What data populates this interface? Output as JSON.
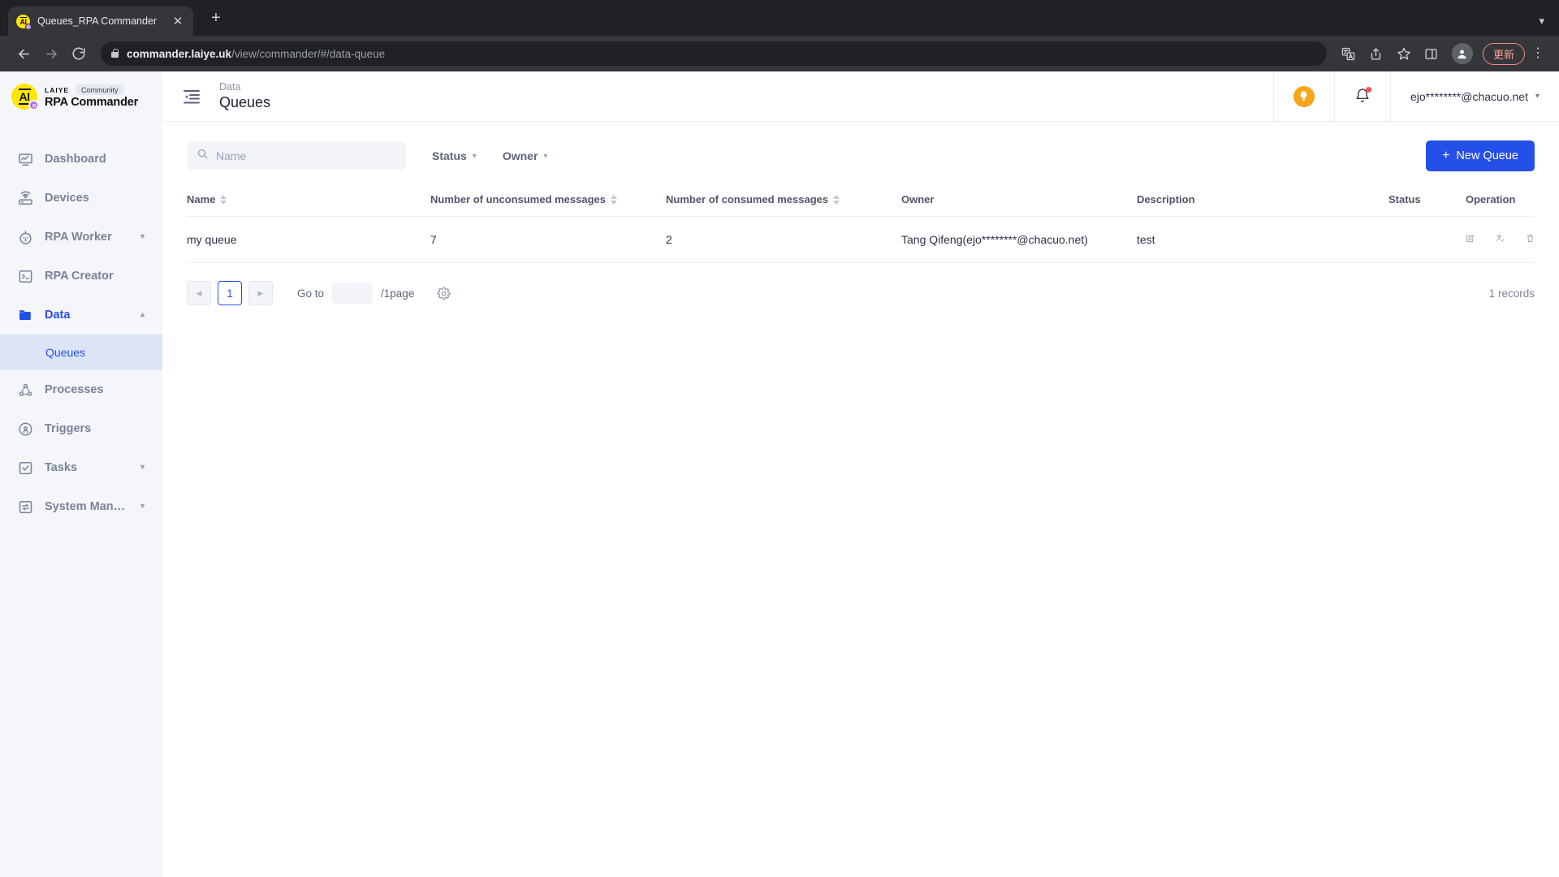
{
  "browser": {
    "tab": {
      "title": "Queues_RPA Commander",
      "favicon_icon": "laiye-ai-favicon",
      "close_icon": "close-icon"
    },
    "new_tab_icon": "plus-icon",
    "window_minimize_icon": "chevron-down-icon",
    "nav": {
      "back_icon": "back-arrow-icon",
      "forward_icon": "forward-arrow-icon",
      "reload_icon": "reload-icon"
    },
    "omnibox": {
      "lock_icon": "lock-icon",
      "domain": "commander.laiye.uk",
      "path": "/view/commander/#/data-queue"
    },
    "toolbar_icons": [
      "translate-icon",
      "share-icon",
      "bookmark-star-icon",
      "side-panel-icon",
      "profile-avatar-icon"
    ],
    "update_label": "更新",
    "menu_icon": "kebab-menu-icon"
  },
  "sidebar": {
    "brand": {
      "laiye": "LAIYE",
      "community": "Community",
      "name": "RPA Commander",
      "logo_icon": "laiye-ai-logo"
    },
    "items": [
      {
        "label": "Dashboard",
        "icon": "dashboard-monitor-icon",
        "expandable": false,
        "active": false
      },
      {
        "label": "Devices",
        "icon": "device-router-icon",
        "expandable": false,
        "active": false
      },
      {
        "label": "RPA Worker",
        "icon": "robot-icon",
        "expandable": true,
        "active": false,
        "chevron": "chevron-down-icon"
      },
      {
        "label": "RPA Creator",
        "icon": "terminal-icon",
        "expandable": false,
        "active": false
      },
      {
        "label": "Data",
        "icon": "folder-icon",
        "expandable": true,
        "active": true,
        "chevron": "chevron-up-icon"
      },
      {
        "label": "Processes",
        "icon": "processes-network-icon",
        "expandable": false,
        "active": false
      },
      {
        "label": "Triggers",
        "icon": "trigger-radar-icon",
        "expandable": false,
        "active": false
      },
      {
        "label": "Tasks",
        "icon": "task-checkbox-icon",
        "expandable": true,
        "active": false,
        "chevron": "chevron-down-icon"
      },
      {
        "label": "System Manag...",
        "icon": "system-transfer-icon",
        "expandable": true,
        "active": false,
        "chevron": "chevron-down-icon"
      }
    ],
    "submenu": {
      "label": "Queues",
      "parent": "Data",
      "active": true
    }
  },
  "header": {
    "collapse_icon": "collapse-sidebar-icon",
    "breadcrumb": "Data",
    "title": "Queues",
    "bulb_icon": "lightbulb-icon",
    "bell_icon": "notification-bell-icon",
    "user_email": "ejo********@chacuo.net",
    "user_chevron_icon": "chevron-down-icon"
  },
  "filters": {
    "search": {
      "placeholder": "Name",
      "value": "",
      "icon": "search-icon"
    },
    "status": {
      "label": "Status",
      "icon": "chevron-down-icon"
    },
    "owner": {
      "label": "Owner",
      "icon": "chevron-down-icon"
    },
    "new_queue": {
      "label": "New Queue",
      "icon": "plus-icon"
    }
  },
  "table": {
    "columns": [
      {
        "label": "Name",
        "sortable": true
      },
      {
        "label": "Number of unconsumed messages",
        "sortable": true
      },
      {
        "label": "Number of consumed messages",
        "sortable": true
      },
      {
        "label": "Owner",
        "sortable": false
      },
      {
        "label": "Description",
        "sortable": false
      },
      {
        "label": "Status",
        "sortable": false
      },
      {
        "label": "Operation",
        "sortable": false
      }
    ],
    "rows": [
      {
        "name": "my queue",
        "unconsumed": "7",
        "consumed": "2",
        "owner": "Tang Qifeng(ejo********@chacuo.net)",
        "description": "test",
        "status_on": true,
        "operations": [
          "edit-icon",
          "assign-user-icon",
          "delete-trash-icon"
        ]
      }
    ]
  },
  "pagination": {
    "prev_icon": "caret-left-icon",
    "current_page": "1",
    "next_icon": "caret-right-icon",
    "goto_label": "Go to",
    "goto_value": "",
    "per_page_label": "/1page",
    "settings_icon": "gear-icon",
    "records_label": "1 records"
  },
  "colors": {
    "accent": "#2550e8",
    "sidebar_bg": "#f4f6fa",
    "submenu_bg": "#dde4f7",
    "brand_yellow": "#ffe600",
    "bulb_orange": "#f7a61b",
    "notification_red": "#ff4d4f",
    "update_pill": "#f08b7a"
  }
}
